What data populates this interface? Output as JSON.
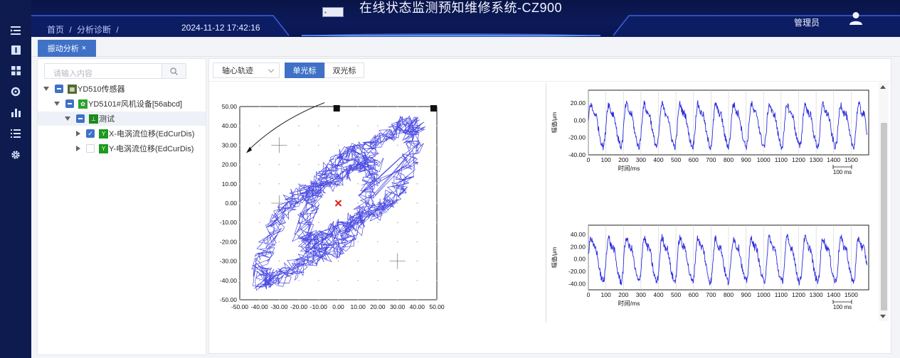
{
  "header": {
    "breadcrumb": [
      "首页",
      "/",
      "分析诊断",
      "/"
    ],
    "datetime": "2024-11-12 17:42:16",
    "title": "在线状态监测预知维修系统-CZ900",
    "user": "管理员"
  },
  "rail": {
    "icons": [
      "menu-fold-icon",
      "info-icon",
      "dashboard-icon",
      "target-icon",
      "bar-chart-icon",
      "list-icon",
      "settings-icon"
    ]
  },
  "tabs": [
    {
      "label": "振动分析",
      "close": "×"
    }
  ],
  "tree": {
    "search_placeholder": "请输入内容",
    "nodes": [
      {
        "label": "YD510传感器",
        "level": 0
      },
      {
        "label": "YD5101#风机设备[56abcd]",
        "level": 1
      },
      {
        "label": "测试",
        "level": 2
      },
      {
        "label": "X-电涡流位移(EdCurDis)",
        "level": 3,
        "checked": true
      },
      {
        "label": "Y-电涡流位移(EdCurDis)",
        "level": 3,
        "checked": false
      }
    ],
    "node_icon_letter": "Y"
  },
  "toolbar": {
    "select_value": "轴心轨迹",
    "single_cursor": "单光标",
    "double_cursor": "双光标"
  },
  "orbit": {
    "y_ticks": [
      "50.00",
      "40.00",
      "30.00",
      "20.00",
      "10.00",
      "0.00",
      "-10.00",
      "-20.00",
      "-30.00",
      "-40.00",
      "-50.00"
    ],
    "x_ticks": [
      "-50.00",
      "-40.00",
      "-30.00",
      "-20.00",
      "-10.00",
      "0.00",
      "10.00",
      "20.00",
      "30.00",
      "40.00",
      "50.00"
    ]
  },
  "waveforms": {
    "x_ticks": [
      "0",
      "100",
      "200",
      "300",
      "400",
      "500",
      "600",
      "700",
      "800",
      "900",
      "1000",
      "1100",
      "1200",
      "1300",
      "1400",
      "1500"
    ],
    "x_label": "时间/ms",
    "y_label": "幅值/μm",
    "scale_label": "100 ms",
    "top_y_ticks": [
      "20.00",
      "0.00",
      "-20.00",
      "-40.00"
    ],
    "bottom_y_ticks": [
      "40.00",
      "20.00",
      "0.00",
      "-20.00",
      "-40.00"
    ]
  },
  "colors": {
    "accent": "#3f72c7",
    "signal": "#2b2bde",
    "header_bg": "#0b1856",
    "marker": "#e02020"
  },
  "chart_data": [
    {
      "type": "scatter",
      "description_kind": "orbit",
      "xlim": [
        -50,
        50
      ],
      "ylim": [
        -50,
        50
      ],
      "x_tick_values": [
        -50,
        -40,
        -30,
        -20,
        -10,
        0,
        10,
        20,
        30,
        40,
        50
      ],
      "y_tick_values": [
        50,
        40,
        30,
        20,
        10,
        0,
        -10,
        -20,
        -30,
        -40,
        -50
      ],
      "center_marker": [
        0,
        0
      ],
      "grid": true
    },
    {
      "type": "line",
      "series": [
        {
          "values": "periodic vibration, period ~100 ms, amplitude ~30 μm"
        }
      ],
      "xlim": [
        0,
        1600
      ],
      "ylim": [
        -40,
        35
      ],
      "x_tick_values": [
        0,
        100,
        200,
        300,
        400,
        500,
        600,
        700,
        800,
        900,
        1000,
        1100,
        1200,
        1300,
        1400,
        1500
      ],
      "y_tick_values": [
        20,
        0,
        -20,
        -40
      ],
      "grid": true
    },
    {
      "type": "line",
      "series": [
        {
          "values": "periodic vibration, period ~100 ms, amplitude ~45 μm"
        }
      ],
      "xlim": [
        0,
        1600
      ],
      "ylim": [
        -50,
        55
      ],
      "x_tick_values": [
        0,
        100,
        200,
        300,
        400,
        500,
        600,
        700,
        800,
        900,
        1000,
        1100,
        1200,
        1300,
        1400,
        1500
      ],
      "y_tick_values": [
        40,
        20,
        0,
        -20,
        -40
      ],
      "grid": true
    }
  ]
}
